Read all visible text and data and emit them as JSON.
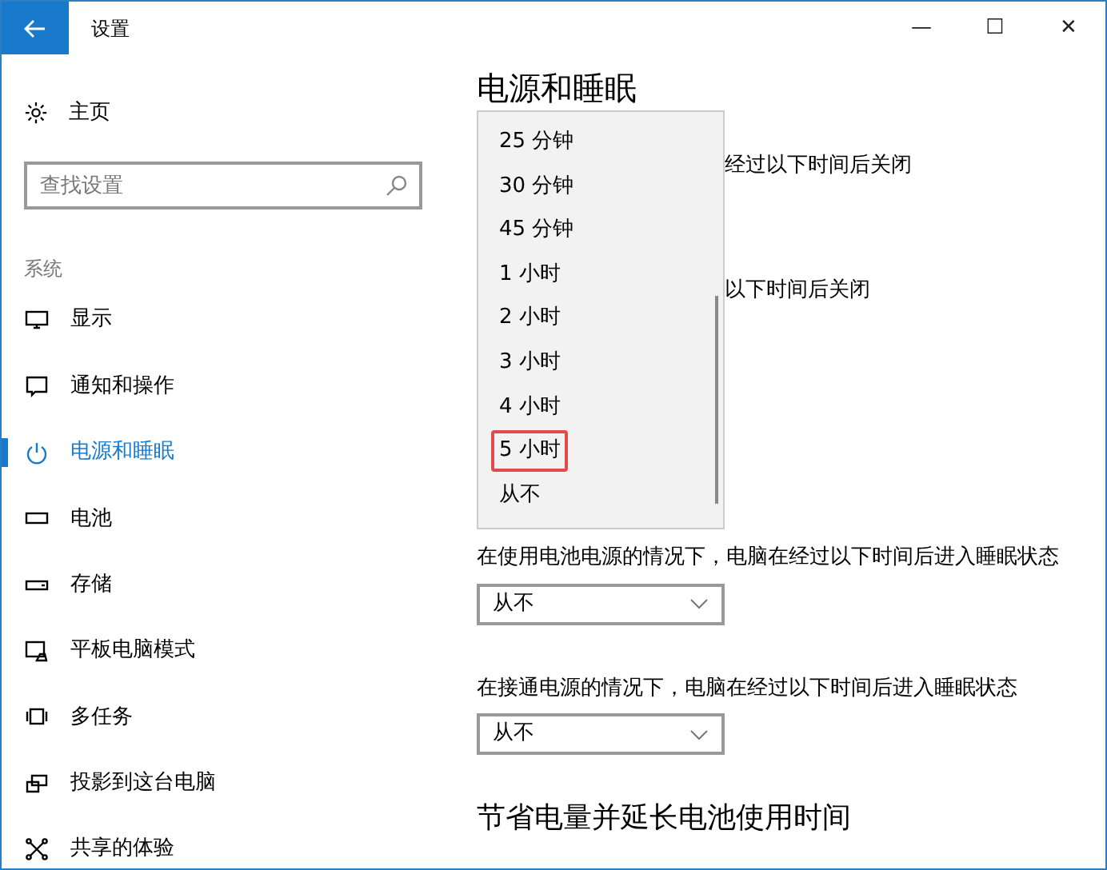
{
  "window": {
    "title": "设置",
    "controls": [
      "—",
      "☐",
      "✕"
    ]
  },
  "sidebar": {
    "home": "主页",
    "search": {
      "placeholder": "查找设置"
    },
    "section": "系统",
    "items": [
      {
        "label": "显示",
        "selected": false
      },
      {
        "label": "通知和操作",
        "selected": false
      },
      {
        "label": "电源和睡眠",
        "selected": true
      },
      {
        "label": "电池",
        "selected": false
      },
      {
        "label": "存储",
        "selected": false
      },
      {
        "label": "平板电脑模式",
        "selected": false
      },
      {
        "label": "多任务",
        "selected": false
      },
      {
        "label": "投影到这台电脑",
        "selected": false
      },
      {
        "label": "共享的体验",
        "selected": false
      }
    ]
  },
  "main": {
    "title": "电源和睡眠",
    "covered_labels": [
      "经过以下时间后关闭",
      "以下时间后关闭"
    ],
    "dropdown": {
      "options": [
        {
          "label": "25 分钟",
          "selected": false
        },
        {
          "label": "30 分钟",
          "selected": false
        },
        {
          "label": "45 分钟",
          "selected": false
        },
        {
          "label": "1 小时",
          "selected": false
        },
        {
          "label": "2 小时",
          "selected": false
        },
        {
          "label": "3 小时",
          "selected": false
        },
        {
          "label": "4 小时",
          "selected": false
        },
        {
          "label": "5 小时",
          "selected": true
        },
        {
          "label": "从不",
          "selected": false
        }
      ]
    },
    "settings": [
      {
        "label": "在使用电池电源的情况下，电脑在经过以下时间后进入睡眠状态",
        "value": "从不"
      },
      {
        "label": "在接通电源的情况下，电脑在经过以下时间后进入睡眠状态",
        "value": "从不"
      }
    ],
    "section_title": "节省电量并延长电池使用时间"
  }
}
